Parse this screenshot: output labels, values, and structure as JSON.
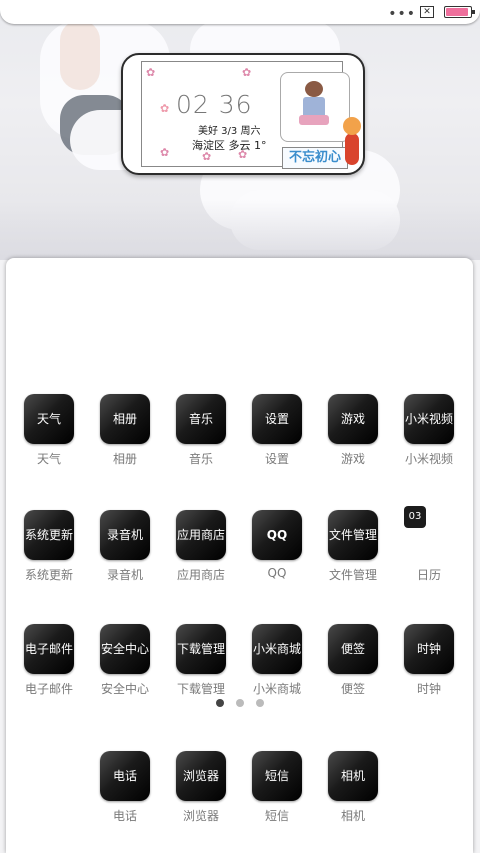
{
  "status_bar": {
    "dots": "•••",
    "x_box": "✕",
    "battery_level": 0.9,
    "battery_color": "#ee6f9c"
  },
  "widget": {
    "time": "02 36",
    "date": "美好  3/3  周六",
    "weather": "海淀区  多云    1°",
    "motto": "不忘初心"
  },
  "apps": {
    "row1": [
      {
        "icon": "天气",
        "label": "天气"
      },
      {
        "icon": "相册",
        "label": "相册"
      },
      {
        "icon": "音乐",
        "label": "音乐"
      },
      {
        "icon": "设置",
        "label": "设置"
      },
      {
        "icon": "游戏",
        "label": "游戏"
      },
      {
        "icon": "小米视频",
        "label": "小米视频"
      }
    ],
    "row2": [
      {
        "icon": "系统更新",
        "label": "系统更新"
      },
      {
        "icon": "录音机",
        "label": "录音机"
      },
      {
        "icon": "应用商店",
        "label": "应用商店"
      },
      {
        "icon": "QQ",
        "label": "QQ"
      },
      {
        "icon": "文件管理",
        "label": "文件管理"
      },
      {
        "icon": "03",
        "label": "日历"
      }
    ],
    "row3": [
      {
        "icon": "电子邮件",
        "label": "电子邮件"
      },
      {
        "icon": "安全中心",
        "label": "安全中心"
      },
      {
        "icon": "下载管理",
        "label": "下载管理"
      },
      {
        "icon": "小米商城",
        "label": "小米商城"
      },
      {
        "icon": "便签",
        "label": "便签"
      },
      {
        "icon": "时钟",
        "label": "时钟"
      }
    ],
    "dock": [
      {
        "icon": "电话",
        "label": "电话"
      },
      {
        "icon": "浏览器",
        "label": "浏览器"
      },
      {
        "icon": "短信",
        "label": "短信"
      },
      {
        "icon": "相机",
        "label": "相机"
      }
    ]
  },
  "pagination": {
    "pages": 3,
    "current": 1
  }
}
